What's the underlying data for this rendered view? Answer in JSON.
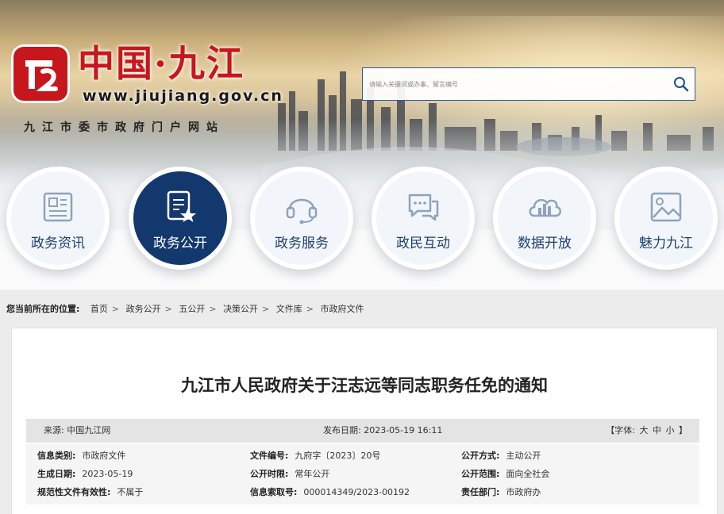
{
  "site": {
    "title": "中国·九江",
    "url": "www.jiujiang.gov.cn",
    "portal_name": "九江市委市政府门户网站"
  },
  "search": {
    "placeholder": "请输入关键词或办事、留言编号"
  },
  "nav": [
    {
      "label": "政务资讯",
      "icon": "newspaper-icon"
    },
    {
      "label": "政务公开",
      "icon": "document-star-icon",
      "active": true
    },
    {
      "label": "政务服务",
      "icon": "headset-icon"
    },
    {
      "label": "政民互动",
      "icon": "chat-bubbles-icon"
    },
    {
      "label": "数据开放",
      "icon": "cloud-bar-chart-icon"
    },
    {
      "label": "魅力九江",
      "icon": "picture-icon"
    }
  ],
  "breadcrumb": {
    "lead": "您当前所在的位置:",
    "items": [
      "首页",
      "政务公开",
      "五公开",
      "决策公开",
      "文件库",
      "市政府文件"
    ]
  },
  "article": {
    "title": "九江市人民政府关于汪志远等同志职务任免的通知",
    "source": "来源:  中国九江网",
    "date": "发布日期:  2023-05-19 16:11",
    "font_size": {
      "prefix": "【字体:",
      "large": "大",
      "medium": "中",
      "small": "小",
      "suffix": "】"
    }
  },
  "meta": [
    [
      {
        "k": "信息类别:",
        "v": "市政府文件"
      },
      {
        "k": "文件编号:",
        "v": "九府字〔2023〕20号"
      },
      {
        "k": "公开方式:",
        "v": "主动公开"
      }
    ],
    [
      {
        "k": "生成日期:",
        "v": "2023-05-19"
      },
      {
        "k": "公开时限:",
        "v": "常年公开"
      },
      {
        "k": "公开范围:",
        "v": "面向全社会"
      }
    ],
    [
      {
        "k": "规范性文件有效性:",
        "v": "不属于"
      },
      {
        "k": "信息索取号:",
        "v": "000014349/2023-00192"
      },
      {
        "k": "责任部门:",
        "v": "市政府办"
      }
    ]
  ]
}
